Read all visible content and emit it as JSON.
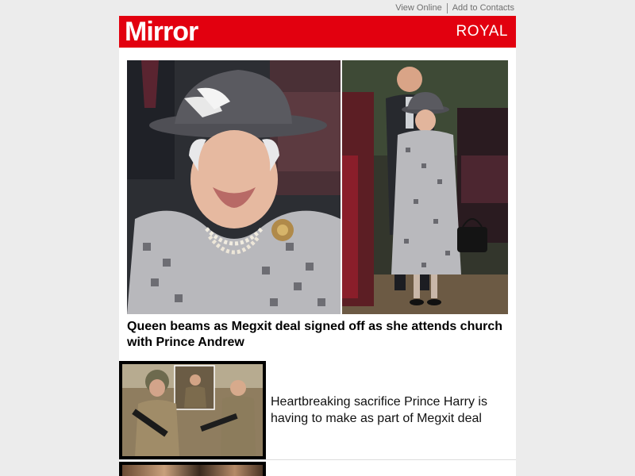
{
  "toplinks": {
    "view_online": "View Online",
    "add_contacts": "Add to Contacts"
  },
  "masthead": {
    "logo": "Mirror",
    "section": "ROYAL",
    "brand_color": "#e2000f"
  },
  "lead_story": {
    "headline": "Queen beams as Megxit deal signed off as she attends church with Prince Andrew"
  },
  "stories": [
    {
      "text": "Heartbreaking sacrifice Prince Harry is having to make as part of Megxit deal"
    }
  ]
}
